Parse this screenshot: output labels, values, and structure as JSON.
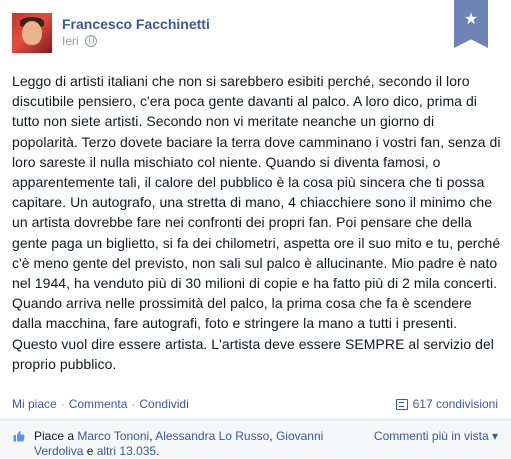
{
  "post": {
    "author": "Francesco Facchinetti",
    "timestamp": "Ieri",
    "privacy_icon": "globe-icon",
    "ribbon_icon": "star-icon",
    "text": "Leggo di artisti italiani che non si sarebbero esibiti perché, secondo il loro\ndiscutibile pensiero, c'era poca gente davanti al palco. A loro dico, prima di\ntutto non siete artisti. Secondo non vi meritate neanche un giorno di\npopolarità. Terzo dovete baciare la terra dove camminano i vostri fan, senza di\nloro sareste il nulla mischiato col niente. Quando si diventa famosi, o\napparentemente tali, il calore del pubblico è la cosa più sincera che ti possa\ncapitare. Un autografo, una stretta di mano, 4 chiacchiere sono il minimo che\nun artista dovrebbe fare nei confronti dei propri fan. Poi pensare che della\ngente paga un biglietto, si fa dei chilometri, aspetta ore il suo mito e tu, perché\nc'è meno gente del previsto, non sali sul palco è allucinante. Mio padre è nato\nnel 1944, ha venduto più di 30 milioni di copie e ha fatto più di 2 mila concerti.\nQuando arriva nelle prossimità del palco, la prima cosa che fa è scendere\ndalla macchina, fare autografi, foto e stringere la mano a tutti i presenti.\nQuesto vuol dire essere artista. L'artista deve essere SEMPRE al servizio del\nproprio pubblico."
  },
  "actions": {
    "like": "Mi piace",
    "comment": "Commenta",
    "share": "Condividi",
    "separator": "·",
    "shares_count": "617 condivisioni"
  },
  "footer": {
    "likes_prefix": "Piace a ",
    "liker_1": "Marco Tononi",
    "sep_1": ", ",
    "liker_2": "Alessandra Lo Russo",
    "sep_2": ", ",
    "liker_3": "Giovanni Verdoliva",
    "sep_3": " e ",
    "others": "altri 13.035",
    "end": ".",
    "more_comments": "Commenti più in vista ▾"
  },
  "colors": {
    "link": "#3b5998",
    "text": "#141823",
    "muted": "#9197a3",
    "ribbon": "#6d84b4"
  }
}
